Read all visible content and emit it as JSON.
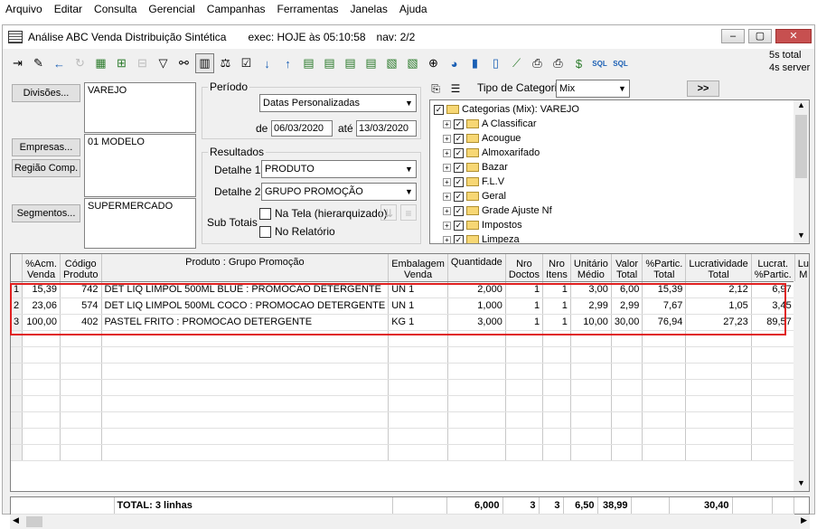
{
  "menu": [
    "Arquivo",
    "Editar",
    "Consulta",
    "Gerencial",
    "Campanhas",
    "Ferramentas",
    "Janelas",
    "Ajuda"
  ],
  "window": {
    "title": "Análise ABC Venda Distribuição Sintética",
    "exec": "exec: HOJE às 05:10:58",
    "nav": "nav: 2/2",
    "controls": [
      "‒",
      "▢",
      "✕"
    ]
  },
  "toolbar": {
    "info_line1": "5s total",
    "info_line2": "4s server",
    "sql_label": "SQL"
  },
  "filters": {
    "divisoes_btn": "Divisões...",
    "divisoes_value": "VAREJO",
    "empresas_btn": "Empresas...",
    "empresas_value": "01 MODELO",
    "regiao_btn": "Região Comp.",
    "segmentos_btn": "Segmentos...",
    "segmentos_value": "SUPERMERCADO"
  },
  "periodo": {
    "legend": "Período",
    "tipo": "Datas Personalizadas",
    "de_label": "de",
    "de": "06/03/2020",
    "ate_label": "até",
    "ate": "13/03/2020"
  },
  "resultados": {
    "legend": "Resultados",
    "detalhe1_label": "Detalhe 1",
    "detalhe1": "PRODUTO",
    "detalhe2_label": "Detalhe 2",
    "detalhe2": "GRUPO PROMOÇÃO",
    "subtotais_label": "Sub Totais",
    "na_tela": "Na Tela (hierarquizado)",
    "no_relatorio": "No Relatório"
  },
  "categoria": {
    "tipo_label": "Tipo de Categoria",
    "tipo_value": "Mix",
    "next_btn": ">>",
    "root": "Categorias (Mix): VAREJO",
    "items": [
      "A Classificar",
      "Acougue",
      "Almoxarifado",
      "Bazar",
      "F.L.V",
      "Geral",
      "Grade Ajuste Nf",
      "Impostos",
      "Limpeza"
    ]
  },
  "grid": {
    "headers": [
      {
        "l1": "",
        "l2": ""
      },
      {
        "l1": "%Acm.",
        "l2": "Venda"
      },
      {
        "l1": "Código",
        "l2": "Produto"
      },
      {
        "l1": "Produto : Grupo Promoção",
        "l2": ""
      },
      {
        "l1": "Embalagem",
        "l2": "Venda"
      },
      {
        "l1": "Quantidade",
        "l2": ""
      },
      {
        "l1": "Nro",
        "l2": "Doctos"
      },
      {
        "l1": "Nro",
        "l2": "Itens"
      },
      {
        "l1": "Unitário",
        "l2": "Médio"
      },
      {
        "l1": "Valor",
        "l2": "Total"
      },
      {
        "l1": "%Partic.",
        "l2": "Total"
      },
      {
        "l1": "Lucratividade",
        "l2": "Total"
      },
      {
        "l1": "Lucrat.",
        "l2": "%Partic."
      },
      {
        "l1": "Lu",
        "l2": "M"
      }
    ],
    "rows": [
      [
        "1",
        "15,39",
        "742",
        "DET LIQ LIMPOL 500ML BLUE : PROMOCAO DETERGENTE",
        "UN 1",
        "2,000",
        "1",
        "1",
        "3,00",
        "6,00",
        "15,39",
        "2,12",
        "6,97",
        ""
      ],
      [
        "2",
        "23,06",
        "574",
        "DET LIQ LIMPOL 500ML COCO : PROMOCAO DETERGENTE",
        "UN 1",
        "1,000",
        "1",
        "1",
        "2,99",
        "2,99",
        "7,67",
        "1,05",
        "3,45",
        ""
      ],
      [
        "3",
        "100,00",
        "402",
        "PASTEL FRITO : PROMOCAO DETERGENTE",
        "KG 1",
        "3,000",
        "1",
        "1",
        "10,00",
        "30,00",
        "76,94",
        "27,23",
        "89,57",
        ""
      ]
    ],
    "totals": {
      "label": "TOTAL: 3 linhas",
      "quantidade": "6,000",
      "doctos": "3",
      "itens": "3",
      "unitario": "6,50",
      "valor": "38,99",
      "lucratividade": "30,40"
    }
  }
}
